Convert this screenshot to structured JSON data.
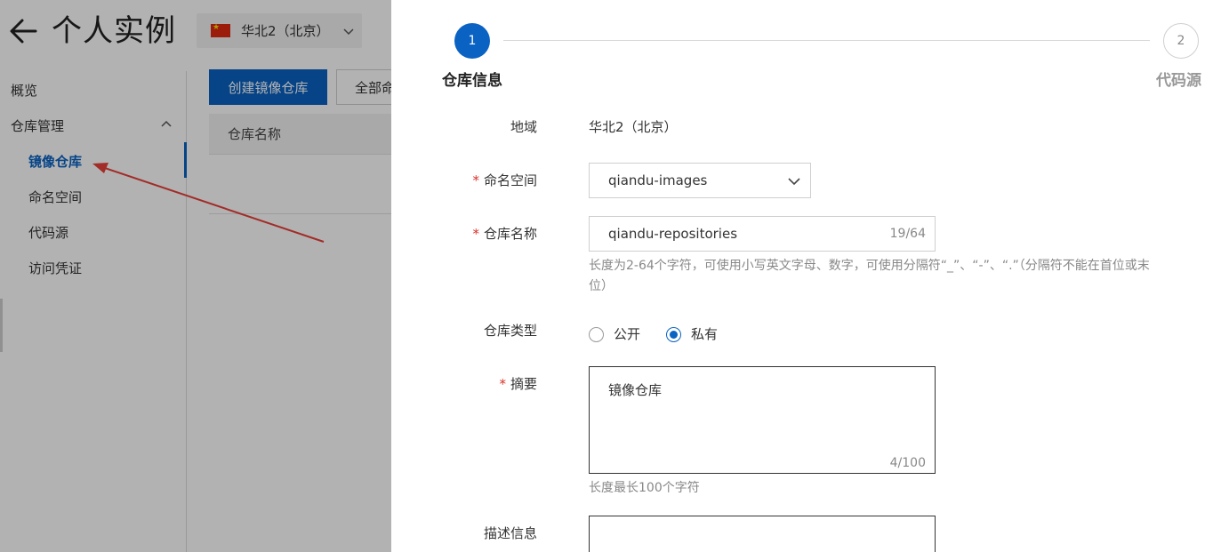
{
  "header": {
    "title": "个人实例",
    "region": "华北2（北京）"
  },
  "sidebar": {
    "items": [
      {
        "label": "概览"
      },
      {
        "label": "仓库管理"
      },
      {
        "label": "镜像仓库"
      },
      {
        "label": "命名空间"
      },
      {
        "label": "代码源"
      },
      {
        "label": "访问凭证"
      }
    ]
  },
  "main": {
    "create_button": "创建镜像仓库",
    "filter_button": "全部命",
    "table_header": "仓库名称"
  },
  "drawer": {
    "steps": [
      {
        "number": "1",
        "label": "仓库信息"
      },
      {
        "number": "2",
        "label": "代码源"
      }
    ],
    "form": {
      "region_label": "地域",
      "region_value": "华北2（北京）",
      "namespace_label": "命名空间",
      "namespace_value": "qiandu-images",
      "repo_name_label": "仓库名称",
      "repo_name_value": "qiandu-repositories",
      "repo_name_counter": "19/64",
      "repo_name_hint": "长度为2-64个字符，可使用小写英文字母、数字，可使用分隔符“_”、“-”、“.”（分隔符不能在首位或末位）",
      "repo_type_label": "仓库类型",
      "repo_type_options": [
        "公开",
        "私有"
      ],
      "repo_type_selected": "私有",
      "summary_label": "摘要",
      "summary_value": "镜像仓库",
      "summary_counter": "4/100",
      "summary_hint": "长度最长100个字符",
      "description_label": "描述信息",
      "required_mark": "*"
    }
  },
  "colors": {
    "primary": "#0a62c2",
    "required": "#d93026",
    "annotation_arrow": "#e8403a"
  }
}
